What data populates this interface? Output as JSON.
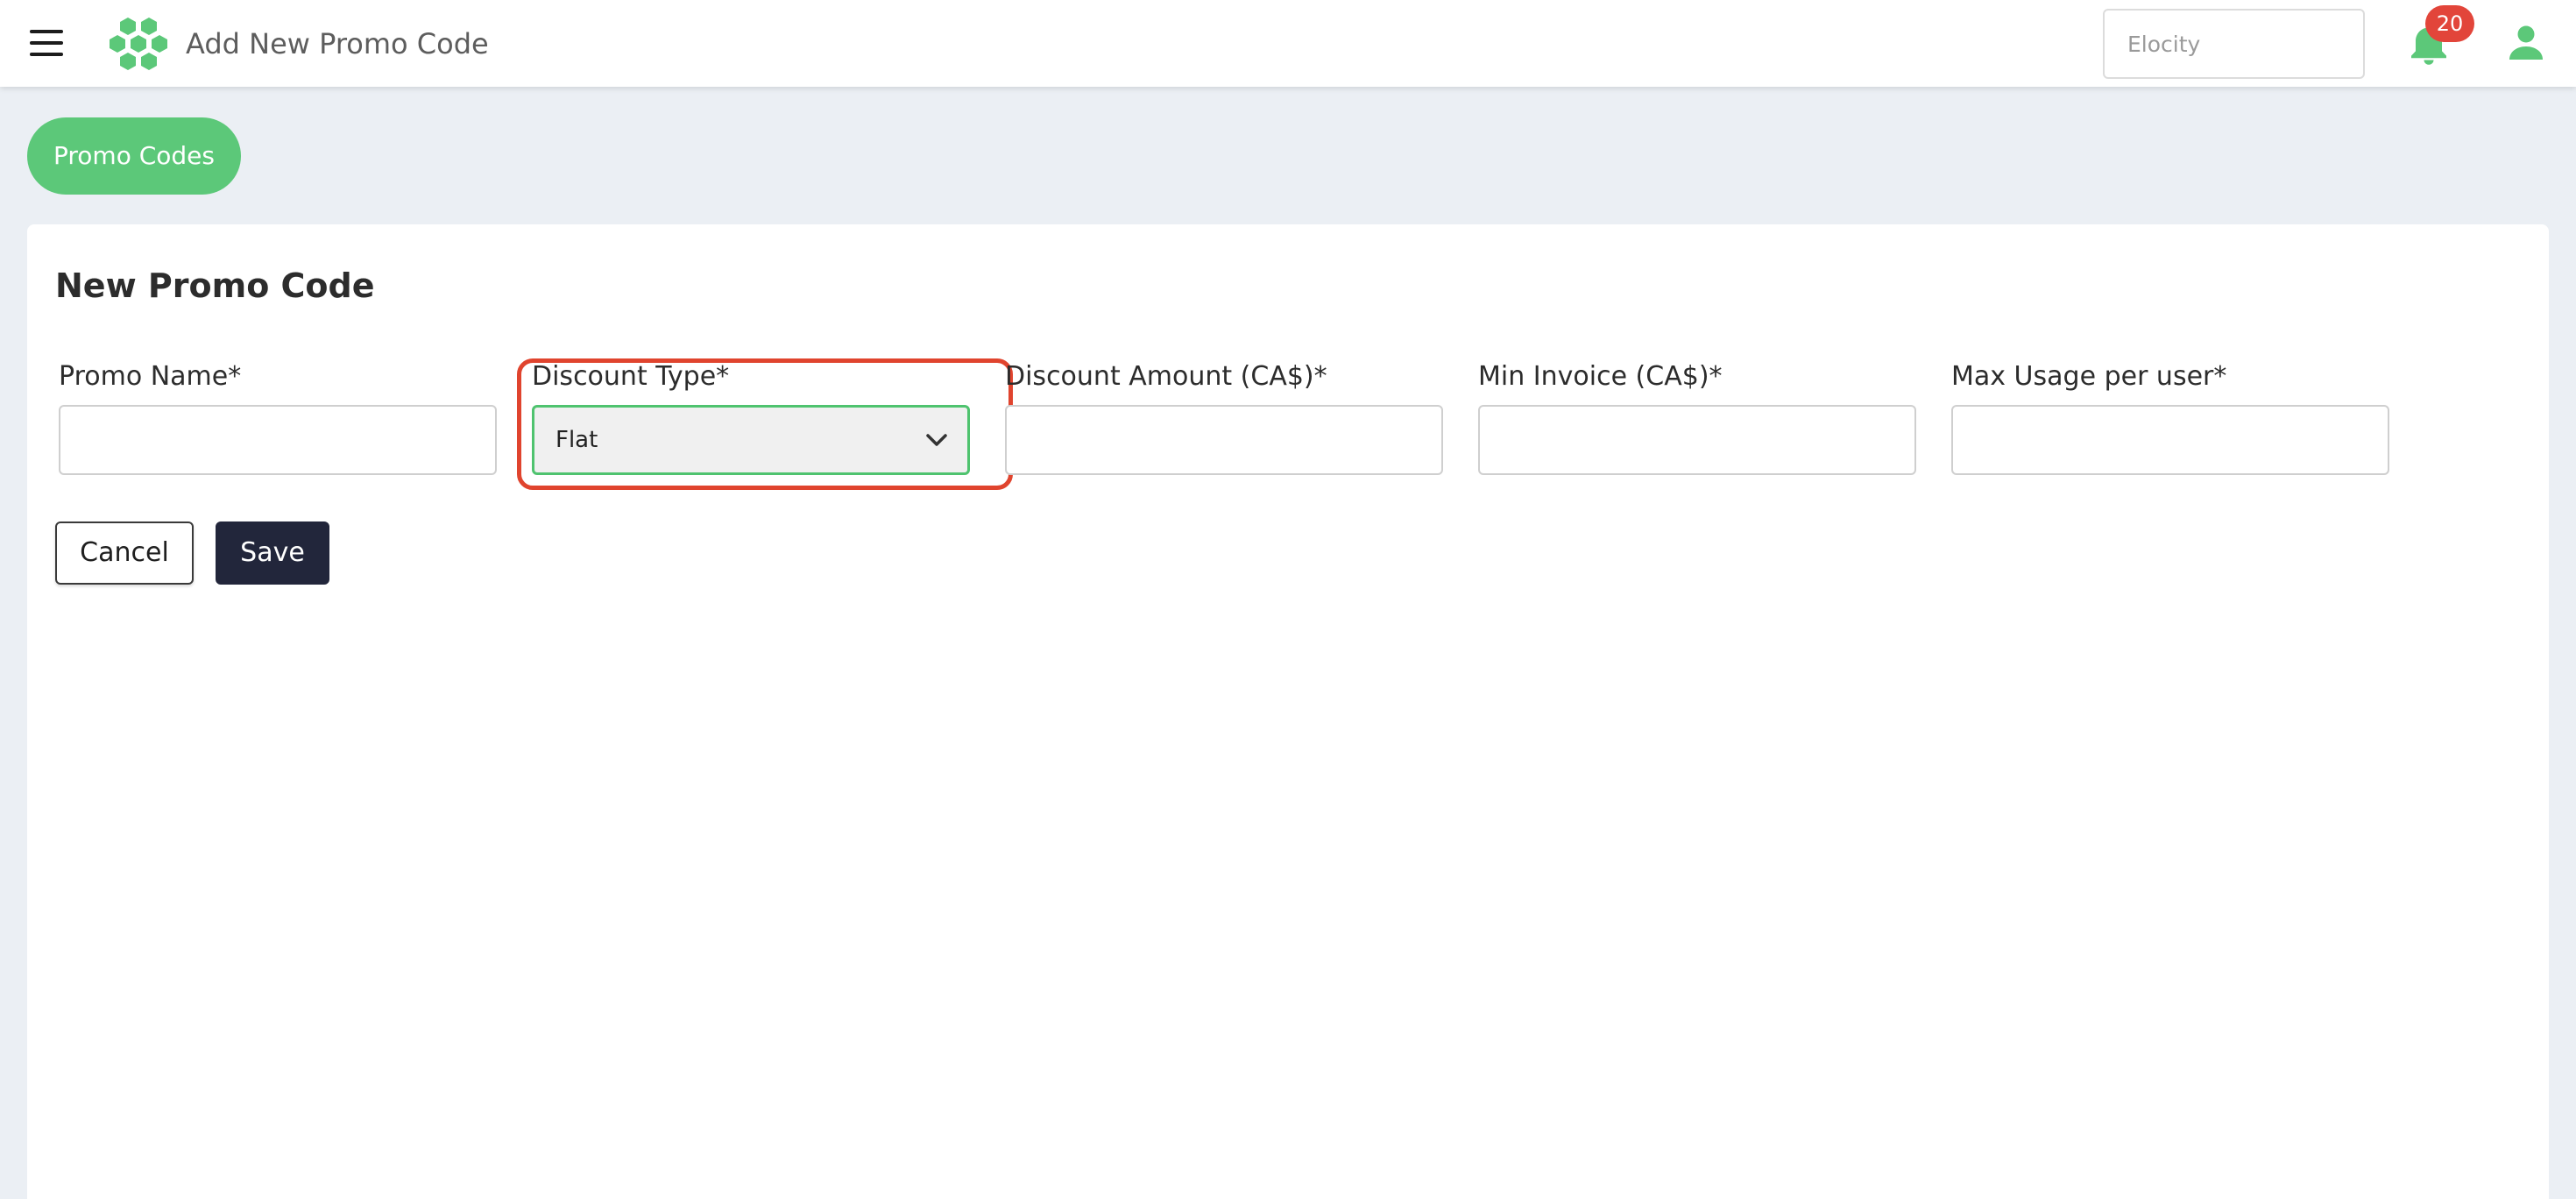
{
  "header": {
    "title": "Add New Promo Code",
    "search_placeholder": "Elocity",
    "notification_count": "20",
    "menu_icon": "hamburger-icon",
    "logo_icon": "hexagon-cluster-logo",
    "bell_icon": "bell-icon",
    "user_icon": "user-icon"
  },
  "breadcrumb": {
    "label": "Promo Codes"
  },
  "form": {
    "title": "New Promo Code",
    "fields": {
      "promo_name": {
        "label": "Promo Name*",
        "value": ""
      },
      "discount_type": {
        "label": "Discount Type*",
        "value": "Flat"
      },
      "discount_amount": {
        "label": "Discount Amount (CA$)*",
        "value": ""
      },
      "min_invoice": {
        "label": "Min Invoice (CA$)*",
        "value": ""
      },
      "max_usage": {
        "label": "Max Usage per user*",
        "value": ""
      }
    },
    "buttons": {
      "cancel": "Cancel",
      "save": "Save"
    }
  },
  "colors": {
    "brand_green": "#5cc879",
    "focus_green": "#4fc36f",
    "highlight_red": "#e0442e",
    "badge_red": "#e2453a",
    "save_navy": "#22263b",
    "page_background": "#ebeff4"
  }
}
